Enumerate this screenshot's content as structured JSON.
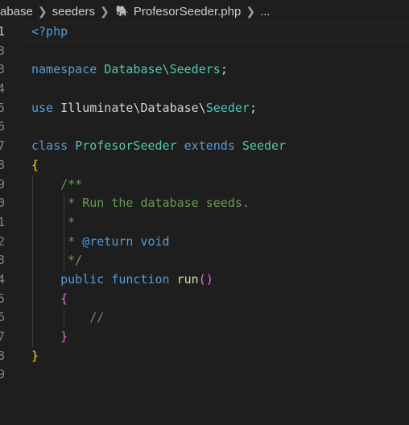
{
  "breadcrumb": {
    "items": [
      "abase",
      "seeders",
      "ProfesorSeeder.php",
      "..."
    ]
  },
  "editor": {
    "line_numbers": [
      "1",
      "3",
      "3",
      "4",
      "5",
      "6",
      "7",
      "8",
      "9",
      "0",
      "1",
      "2",
      "3",
      "4",
      "5",
      "6",
      "7",
      "8",
      "9"
    ],
    "active_line": 1,
    "tokens": {
      "l1": "<?php",
      "l3_kw": "namespace",
      "l3_ns": "Database\\Seeders",
      "l3_semi": ";",
      "l5_kw": "use",
      "l5_ns": "Illuminate\\Database\\",
      "l5_cls": "Seeder",
      "l5_semi": ";",
      "l7_kw1": "class",
      "l7_name": "ProfesorSeeder",
      "l7_kw2": "extends",
      "l7_parent": "Seeder",
      "l8": "{",
      "l9": "/**",
      "l10": "* Run the database seeds.",
      "l11": "*",
      "l12_star": "* ",
      "l12_tag": "@return",
      "l12_type": "void",
      "l13": "*/",
      "l14_kw1": "public",
      "l14_kw2": "function",
      "l14_fn": "run",
      "l14_parens": "()",
      "l15": "{",
      "l16": "//",
      "l17": "}",
      "l18": "}"
    }
  },
  "colors": {
    "background": "#1e1e1e",
    "keyword": "#569cd6",
    "type": "#4ec9b0",
    "function": "#dcdcaa",
    "comment": "#6a9955",
    "bracket1": "#ffd700",
    "bracket2": "#da70d6",
    "bracket3": "#179fff"
  }
}
